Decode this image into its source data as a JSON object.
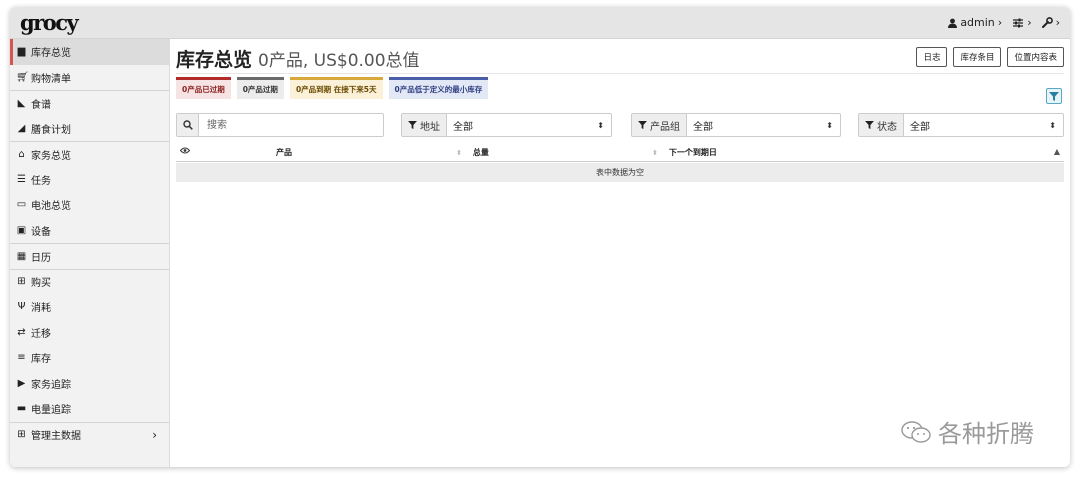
{
  "app": {
    "logo": "grocy"
  },
  "topbar": {
    "user": "admin"
  },
  "sidebar": {
    "items": [
      {
        "label": "库存总览",
        "icon": "box-icon"
      },
      {
        "label": "购物清单",
        "icon": "cart-icon"
      },
      {
        "label": "食谱",
        "icon": "pizza-icon"
      },
      {
        "label": "膳食计划",
        "icon": "paper-plane-icon"
      },
      {
        "label": "家务总览",
        "icon": "home-icon"
      },
      {
        "label": "任务",
        "icon": "tasks-icon"
      },
      {
        "label": "电池总览",
        "icon": "battery-icon"
      },
      {
        "label": "设备",
        "icon": "toolbox-icon"
      },
      {
        "label": "日历",
        "icon": "calendar-icon"
      },
      {
        "label": "购买",
        "icon": "cart-plus-icon"
      },
      {
        "label": "消耗",
        "icon": "utensils-icon"
      },
      {
        "label": "迁移",
        "icon": "exchange-icon"
      },
      {
        "label": "库存",
        "icon": "list-icon"
      },
      {
        "label": "家务追踪",
        "icon": "play-icon"
      },
      {
        "label": "电量追踪",
        "icon": "car-battery-icon"
      },
      {
        "label": "管理主数据",
        "icon": "table-icon"
      }
    ]
  },
  "page": {
    "title": "库存总览",
    "subtitle": "0产品, US$0.00总值",
    "buttons": [
      "日志",
      "库存条目",
      "位置内容表"
    ]
  },
  "badges": [
    {
      "text": "0产品已过期",
      "color": "#b42b2b"
    },
    {
      "text": "0产品过期",
      "color": "#6a6a6a"
    },
    {
      "text": "0产品到期 在接下来5天",
      "color": "#d8a93a"
    },
    {
      "text": "0产品低于定义的最小库存",
      "color": "#4b5fa8"
    }
  ],
  "filters": {
    "search_placeholder": "搜索",
    "location_label": "地址",
    "location_value": "全部",
    "group_label": "产品组",
    "group_value": "全部",
    "status_label": "状态",
    "status_value": "全部"
  },
  "table": {
    "columns": [
      "产品",
      "总量",
      "下一个到期日"
    ],
    "empty_text": "表中数据为空"
  },
  "watermark": {
    "text": "各种折腾"
  }
}
